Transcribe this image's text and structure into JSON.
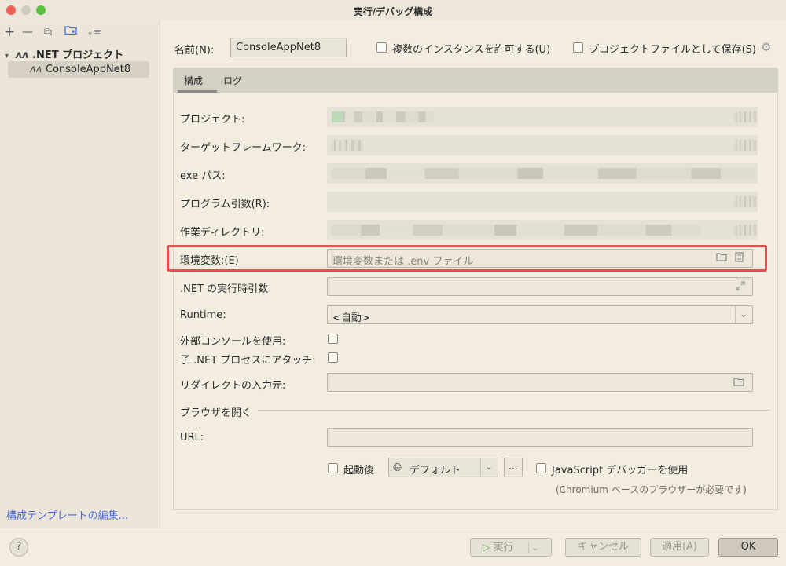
{
  "window": {
    "title": "実行/デバッグ構成"
  },
  "sidebar": {
    "toolbar": {
      "add": "+",
      "remove": "—",
      "copy": "⧉",
      "folder": "📁",
      "sort": "↓≡"
    },
    "tree_root": ".NET プロジェクト",
    "tree_item": "ConsoleAppNet8",
    "template_link": "構成テンプレートの編集..."
  },
  "header": {
    "name_label": "名前(N):",
    "name_value": "ConsoleAppNet8",
    "allow_multiple_label": "複数のインスタンスを許可する(U)",
    "save_as_project_label": "プロジェクトファイルとして保存(S)"
  },
  "tabs": [
    {
      "label": "構成"
    },
    {
      "label": "ログ"
    }
  ],
  "form": {
    "project_label": "プロジェクト:",
    "target_framework_label": "ターゲットフレームワーク:",
    "exe_path_label": "exe パス:",
    "program_args_label": "プログラム引数(R):",
    "working_dir_label": "作業ディレクトリ:",
    "env_vars_label": "環境変数:(E)",
    "env_vars_placeholder": "環境変数または .env ファイル",
    "runtime_args_label": ".NET の実行時引数:",
    "runtime_label": "Runtime:",
    "runtime_value": "<自動>",
    "external_console_label": "外部コンソールを使用:",
    "attach_child_label": "子 .NET プロセスにアタッチ:",
    "redirect_input_label": "リダイレクトの入力元:",
    "browser_section": "ブラウザを開く",
    "url_label": "URL:",
    "after_launch_label": "起動後",
    "browser_default": "デフォルト",
    "browser_more": "...",
    "js_debugger_label": "JavaScript デバッガーを使用",
    "chromium_note": "(Chromium ベースのブラウザーが必要です)"
  },
  "footer": {
    "help": "?",
    "run": "実行",
    "cancel": "キャンセル",
    "apply": "適用(A)",
    "ok": "OK"
  },
  "colors": {
    "highlight": "#e0504f",
    "link": "#4a6bd6"
  }
}
